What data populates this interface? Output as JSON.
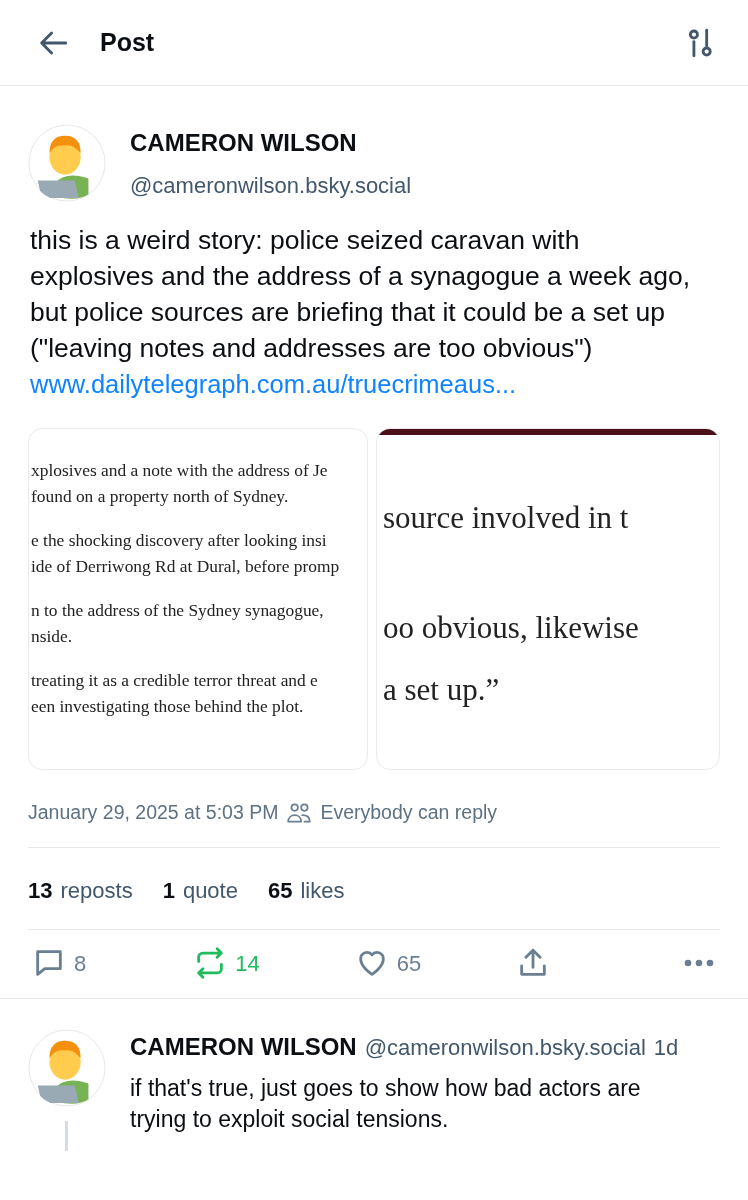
{
  "header": {
    "title": "Post"
  },
  "post": {
    "author": {
      "name": "CAMERON WILSON",
      "handle": "@cameronwilson.bsky.social"
    },
    "text": "this is a weird story: police seized caravan with explosives and the address of a synagogue a week ago, but police sources are briefing that it could be a set up (\"leaving notes and addresses are too obvious\")",
    "link": "www.dailytelegraph.com.au/truecrimeaus...",
    "images": [
      {
        "kind": "excerpt",
        "paragraphs": [
          [
            "xplosives and a note with the address of Je",
            "found on a property north of Sydney."
          ],
          [
            "e the shocking discovery after looking insi",
            "ide of Derriwong Rd at Dural, before promp"
          ],
          [
            "n to the address of the Sydney synagogue,",
            "nside."
          ],
          [
            "treating it as a credible terror threat and e",
            "een investigating those behind the plot."
          ]
        ]
      },
      {
        "kind": "closeup",
        "paragraphs": [
          [
            "source involved in t"
          ],
          [
            "oo obvious, likewise",
            "a set up.”"
          ]
        ]
      }
    ],
    "timestamp": "January 29, 2025 at 5:03 PM",
    "reply_setting": "Everybody can reply",
    "stats": [
      {
        "count": "13",
        "label": "reposts"
      },
      {
        "count": "1",
        "label": "quote"
      },
      {
        "count": "65",
        "label": "likes"
      }
    ],
    "actions": [
      {
        "kind": "reply",
        "count": "8",
        "active": false
      },
      {
        "kind": "repost",
        "count": "14",
        "active": true
      },
      {
        "kind": "like",
        "count": "65",
        "active": false
      },
      {
        "kind": "share"
      },
      {
        "kind": "more"
      }
    ]
  },
  "reply": {
    "name": "CAMERON WILSON",
    "handle": "@cameronwilson.bsky.social",
    "time": "1d",
    "text": "if that's true, just goes to show how bad actors are trying to exploit social tensions."
  }
}
